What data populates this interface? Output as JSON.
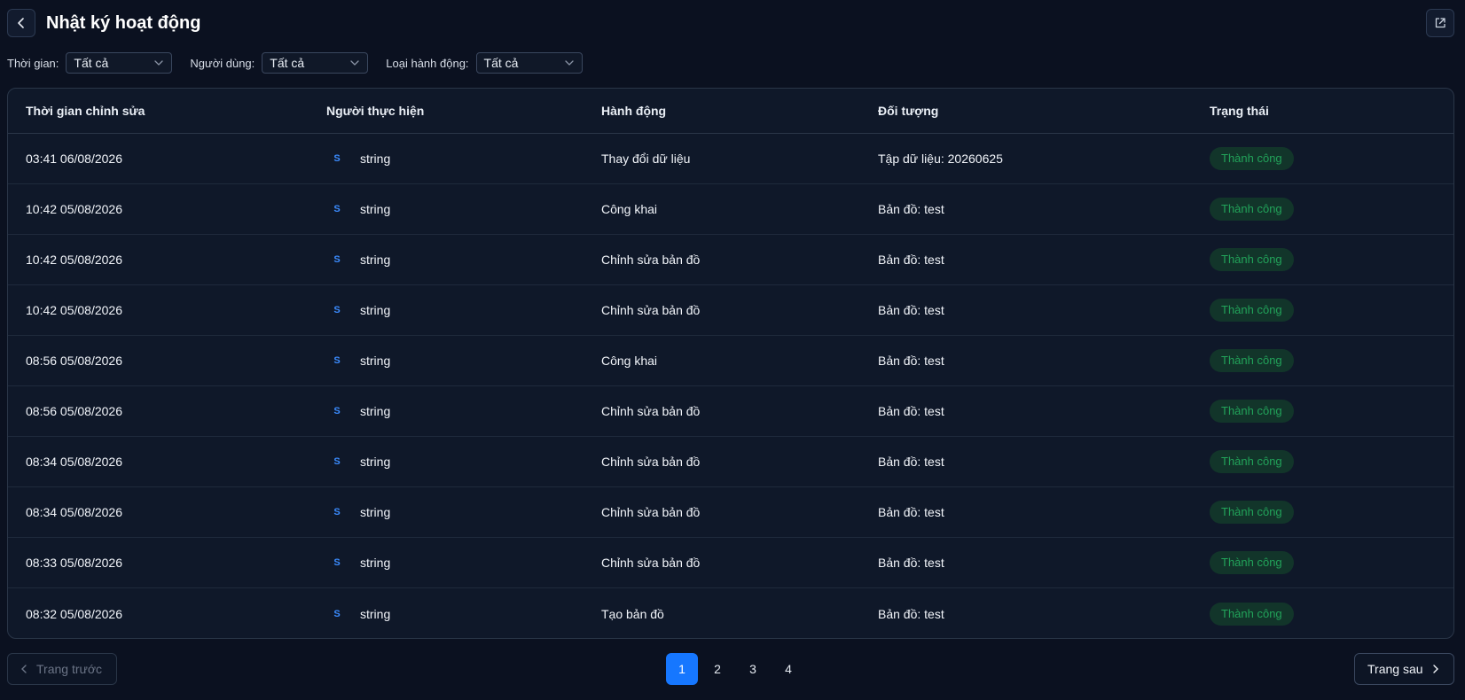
{
  "header": {
    "title": "Nhật ký hoạt động",
    "back_icon": "chevron-left-icon",
    "export_icon": "external-link-icon"
  },
  "filters": [
    {
      "label": "Thời gian:",
      "value": "Tất cả"
    },
    {
      "label": "Người dùng:",
      "value": "Tất cả"
    },
    {
      "label": "Loại hành động:",
      "value": "Tất cả"
    }
  ],
  "table": {
    "columns": [
      "Thời gian chỉnh sửa",
      "Người thực hiện",
      "Hành động",
      "Đối tượng",
      "Trạng thái"
    ],
    "rows": [
      {
        "time": "03:41 06/08/2026",
        "avatar": "S",
        "user": "string",
        "action": "Thay đổi dữ liệu",
        "object": "Tập dữ liệu: 20260625",
        "status": "Thành công"
      },
      {
        "time": "10:42 05/08/2026",
        "avatar": "S",
        "user": "string",
        "action": "Công khai",
        "object": "Bản đồ: test",
        "status": "Thành công"
      },
      {
        "time": "10:42 05/08/2026",
        "avatar": "S",
        "user": "string",
        "action": "Chỉnh sửa bản đồ",
        "object": "Bản đồ: test",
        "status": "Thành công"
      },
      {
        "time": "10:42 05/08/2026",
        "avatar": "S",
        "user": "string",
        "action": "Chỉnh sửa bản đồ",
        "object": "Bản đồ: test",
        "status": "Thành công"
      },
      {
        "time": "08:56 05/08/2026",
        "avatar": "S",
        "user": "string",
        "action": "Công khai",
        "object": "Bản đồ: test",
        "status": "Thành công"
      },
      {
        "time": "08:56 05/08/2026",
        "avatar": "S",
        "user": "string",
        "action": "Chỉnh sửa bản đồ",
        "object": "Bản đồ: test",
        "status": "Thành công"
      },
      {
        "time": "08:34 05/08/2026",
        "avatar": "S",
        "user": "string",
        "action": "Chỉnh sửa bản đồ",
        "object": "Bản đồ: test",
        "status": "Thành công"
      },
      {
        "time": "08:34 05/08/2026",
        "avatar": "S",
        "user": "string",
        "action": "Chỉnh sửa bản đồ",
        "object": "Bản đồ: test",
        "status": "Thành công"
      },
      {
        "time": "08:33 05/08/2026",
        "avatar": "S",
        "user": "string",
        "action": "Chỉnh sửa bản đồ",
        "object": "Bản đồ: test",
        "status": "Thành công"
      },
      {
        "time": "08:32 05/08/2026",
        "avatar": "S",
        "user": "string",
        "action": "Tạo bản đồ",
        "object": "Bản đồ: test",
        "status": "Thành công"
      }
    ]
  },
  "pagination": {
    "prev_label": "Trang trước",
    "next_label": "Trang sau",
    "pages": [
      "1",
      "2",
      "3",
      "4"
    ],
    "current": "1"
  },
  "colors": {
    "background": "#0b1120",
    "accent": "#1677ff",
    "success_text": "#22a35a",
    "success_bg": "#12352a"
  }
}
